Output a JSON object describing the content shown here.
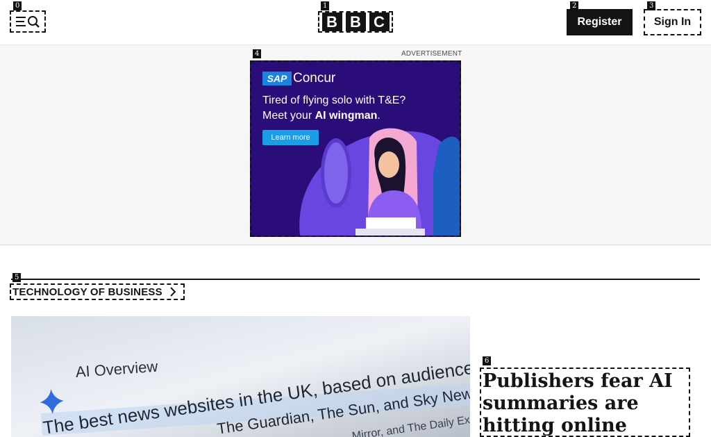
{
  "header": {
    "menu_search_icon": "menu-search-icon",
    "logo_letters": [
      "B",
      "B",
      "C"
    ],
    "register_label": "Register",
    "signin_label": "Sign In"
  },
  "markers": [
    "0",
    "1",
    "2",
    "3",
    "4",
    "5",
    "6"
  ],
  "advertisement": {
    "label": "ADVERTISEMENT",
    "brand_badge": "SAP",
    "brand_name": "Concur",
    "line1": "Tired of flying solo with T&E?",
    "line2_prefix": "Meet your ",
    "line2_bold": "AI wingman",
    "line2_suffix": ".",
    "cta": "Learn more"
  },
  "section": {
    "title": "TECHNOLOGY OF BUSINESS"
  },
  "hero_image": {
    "overview_title": "AI Overview",
    "line1": "The best news websites in the UK, based on audience size and traffic",
    "line2": "The Guardian, The Sun, and Sky News. Others",
    "line3": "Mirror, and The Daily Express"
  },
  "article": {
    "headline": "Publishers fear AI summaries are hitting online traffic"
  },
  "colors": {
    "brand_black": "#141414",
    "ad_background": "#2a0d78",
    "ad_cta": "#1a9ce6"
  }
}
